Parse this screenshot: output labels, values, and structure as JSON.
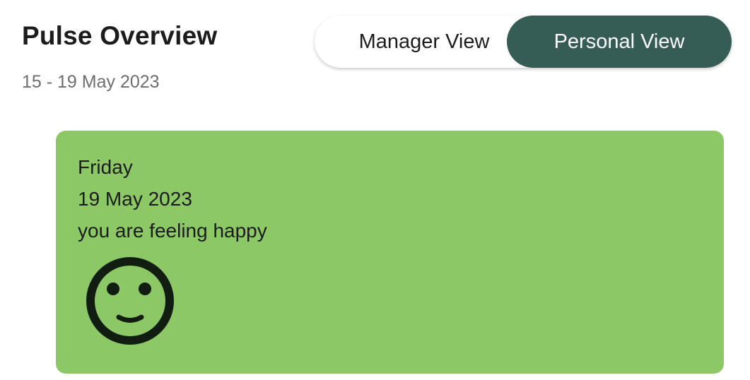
{
  "header": {
    "title": "Pulse Overview",
    "date_range": "15 - 19 May 2023"
  },
  "view_toggle": {
    "options": [
      {
        "label": "Manager View",
        "selected": false
      },
      {
        "label": "Personal View",
        "selected": true
      }
    ]
  },
  "entry": {
    "day": "Friday",
    "date": "19 May 2023",
    "mood_text": "you are feeling happy",
    "mood_icon": "smiley-face-icon"
  },
  "colors": {
    "accent": "#365c56",
    "card": "#8cc865",
    "text": "#1c1c1c",
    "muted": "#6e6e6e"
  }
}
